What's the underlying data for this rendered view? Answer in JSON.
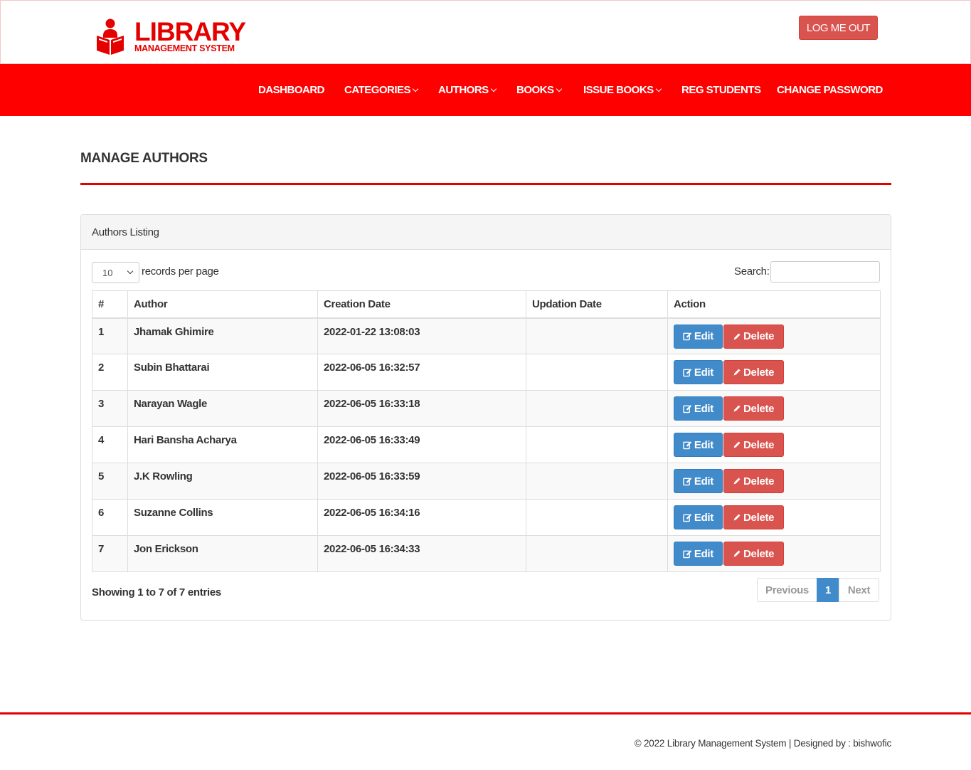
{
  "brand": {
    "title": "LIBRARY",
    "subtitle": "MANAGEMENT SYSTEM",
    "logo_icon": "reader-book-icon",
    "color": "#e50000"
  },
  "header": {
    "logout_label": "LOG ME OUT"
  },
  "nav": {
    "items": [
      {
        "label": "DASHBOARD",
        "dropdown": false
      },
      {
        "label": "CATEGORIES",
        "dropdown": true
      },
      {
        "label": "AUTHORS",
        "dropdown": true
      },
      {
        "label": "BOOKS",
        "dropdown": true
      },
      {
        "label": "ISSUE BOOKS",
        "dropdown": true
      },
      {
        "label": "REG STUDENTS",
        "dropdown": false
      },
      {
        "label": "CHANGE PASSWORD",
        "dropdown": false
      }
    ],
    "background": "#ff0000"
  },
  "page": {
    "title": "MANAGE AUTHORS"
  },
  "panel": {
    "heading": "Authors Listing",
    "length_value": "10",
    "length_label": "records per page",
    "search_label": "Search:",
    "search_value": ""
  },
  "table": {
    "columns": [
      "#",
      "Author",
      "Creation Date",
      "Updation Date",
      "Action"
    ],
    "edit_label": "Edit",
    "delete_label": "Delete",
    "rows": [
      {
        "num": "1",
        "author": "Jhamak Ghimire",
        "created": "2022-01-22 13:08:03",
        "updated": ""
      },
      {
        "num": "2",
        "author": "Subin Bhattarai",
        "created": "2022-06-05 16:32:57",
        "updated": ""
      },
      {
        "num": "3",
        "author": "Narayan Wagle",
        "created": "2022-06-05 16:33:18",
        "updated": ""
      },
      {
        "num": "4",
        "author": "Hari Bansha Acharya",
        "created": "2022-06-05 16:33:49",
        "updated": ""
      },
      {
        "num": "5",
        "author": "J.K Rowling",
        "created": "2022-06-05 16:33:59",
        "updated": ""
      },
      {
        "num": "6",
        "author": "Suzanne Collins",
        "created": "2022-06-05 16:34:16",
        "updated": ""
      },
      {
        "num": "7",
        "author": "Jon Erickson",
        "created": "2022-06-05 16:34:33",
        "updated": ""
      }
    ]
  },
  "pagination": {
    "info": "Showing 1 to 7 of 7 entries",
    "previous": "Previous",
    "current": "1",
    "next": "Next"
  },
  "footer": {
    "text": "© 2022 Library Management System | Designed by : bishwofic"
  },
  "colors": {
    "edit_button": "#428bca",
    "delete_button": "#d9534f",
    "accent": "#e50000"
  }
}
